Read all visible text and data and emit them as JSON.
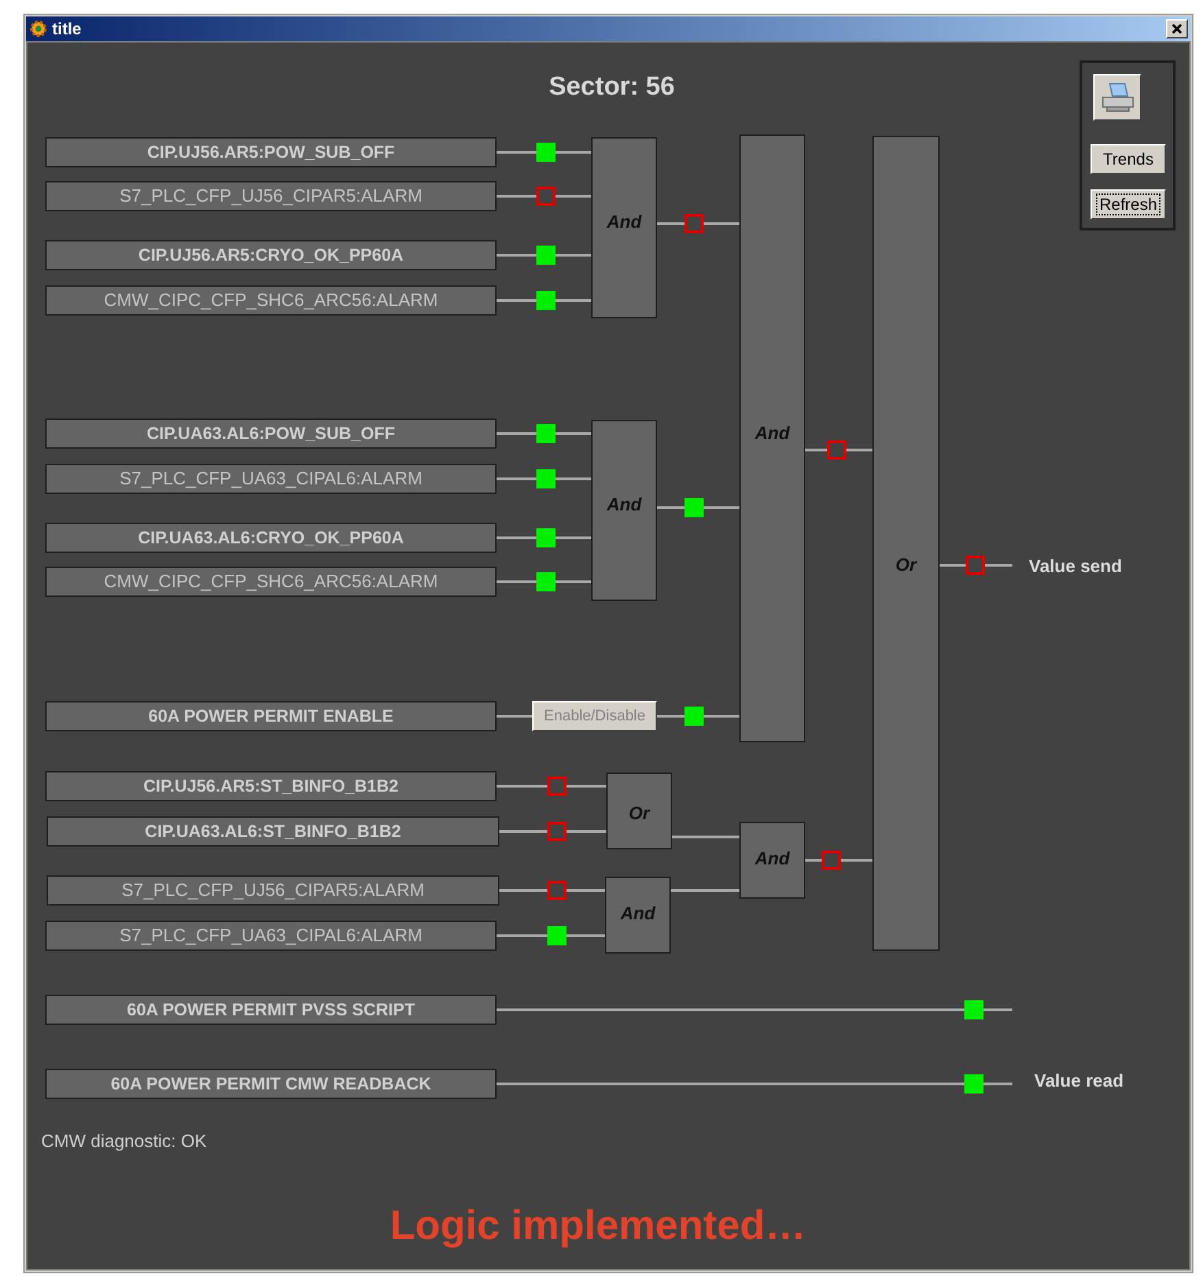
{
  "window": {
    "title": "title"
  },
  "heading": "Sector: 56",
  "side_buttons": [
    {
      "label": "Trends",
      "focused": false
    },
    {
      "label": "Refresh",
      "focused": true
    }
  ],
  "signals": [
    {
      "kind": "gate-input",
      "label": "CIP.UJ56.AR5:POW_SUB_OFF",
      "bold": true,
      "on": true
    },
    {
      "kind": "gate-input",
      "label": "S7_PLC_CFP_UJ56_CIPAR5:ALARM",
      "bold": false,
      "on": false
    },
    {
      "kind": "gate-input",
      "label": "CIP.UJ56.AR5:CRYO_OK_PP60A",
      "bold": true,
      "on": true
    },
    {
      "kind": "gate-input",
      "label": "CMW_CIPC_CFP_SHC6_ARC56:ALARM",
      "bold": false,
      "on": true
    },
    {
      "kind": "gate-input",
      "label": "CIP.UA63.AL6:POW_SUB_OFF",
      "bold": true,
      "on": true
    },
    {
      "kind": "gate-input",
      "label": "S7_PLC_CFP_UA63_CIPAL6:ALARM",
      "bold": false,
      "on": true
    },
    {
      "kind": "gate-input",
      "label": "CIP.UA63.AL6:CRYO_OK_PP60A",
      "bold": true,
      "on": true
    },
    {
      "kind": "gate-input",
      "label": "CMW_CIPC_CFP_SHC6_ARC56:ALARM",
      "bold": false,
      "on": true
    },
    {
      "kind": "enable",
      "label": "60A POWER PERMIT ENABLE",
      "bold": true,
      "button": "Enable/Disable",
      "on": true
    },
    {
      "kind": "gate-input",
      "label": "CIP.UJ56.AR5:ST_BINFO_B1B2",
      "bold": true,
      "on": false
    },
    {
      "kind": "gate-input",
      "label": "CIP.UA63.AL6:ST_BINFO_B1B2",
      "bold": true,
      "on": false
    },
    {
      "kind": "gate-input",
      "label": "S7_PLC_CFP_UJ56_CIPAR5:ALARM",
      "bold": false,
      "on": false
    },
    {
      "kind": "gate-input",
      "label": "S7_PLC_CFP_UA63_CIPAL6:ALARM",
      "bold": false,
      "on": true
    },
    {
      "kind": "direct",
      "label": "60A POWER PERMIT PVSS SCRIPT",
      "bold": true,
      "on": true
    },
    {
      "kind": "direct",
      "label": "60A POWER PERMIT CMW READBACK",
      "bold": true,
      "on": true,
      "output_label": "Value read"
    }
  ],
  "gates": [
    {
      "label": "And",
      "output_on": false
    },
    {
      "label": "And",
      "output_on": true
    },
    {
      "label": "And",
      "output_on": false
    },
    {
      "label": "Or",
      "output_on": false,
      "output_label": "Value send"
    },
    {
      "label": "Or"
    },
    {
      "label": "And"
    },
    {
      "label": "And",
      "output_on": false
    }
  ],
  "diagnostic": "CMW diagnostic: OK",
  "note": "Logic implemented…"
}
